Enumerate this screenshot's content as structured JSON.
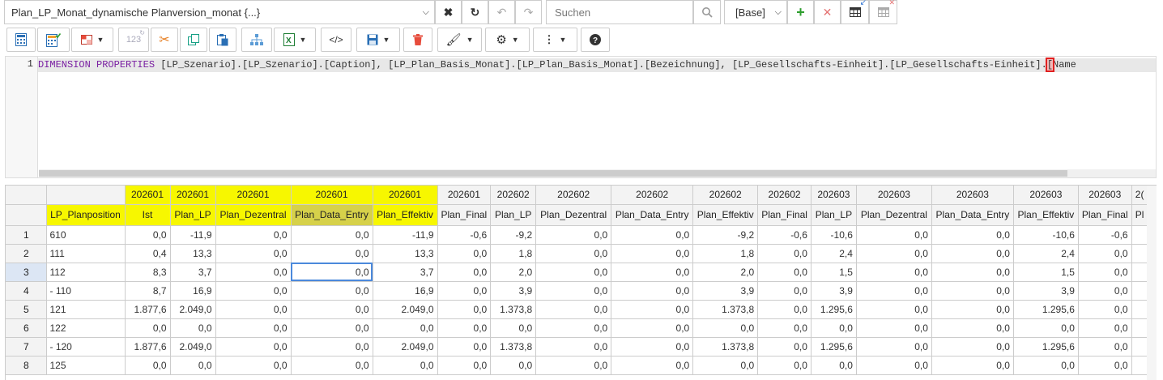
{
  "topbar": {
    "query_select": "Plan_LP_Monat_dynamische Planversion_monat {...}",
    "search_placeholder": "Suchen",
    "database_select": "[Base]"
  },
  "toolbar": {
    "paging_label": "123"
  },
  "editor": {
    "line_number": "1",
    "code_kw1": "DIMENSION PROPERTIES",
    "code_text": " [LP_Szenario].[LP_Szenario].[Caption], [LP_Plan_Basis_Monat].[LP_Plan_Basis_Monat].[Bezeichnung], [LP_Gesellschafts-Einheit].[LP_Gesellschafts-Einheit].",
    "code_bracket": "[",
    "code_tail": "Name"
  },
  "grid": {
    "header_periods": [
      "202601",
      "202601",
      "202601",
      "202601",
      "202601",
      "202601",
      "202602",
      "202602",
      "202602",
      "202602",
      "202602",
      "202603",
      "202603",
      "202603",
      "202603",
      "202603",
      "2("
    ],
    "row_header_title": "LP_Planposition",
    "header_measures": [
      "Ist",
      "Plan_LP",
      "Plan_Dezentral",
      "Plan_Data_Entry",
      "Plan_Effektiv",
      "Plan_Final",
      "Plan_LP",
      "Plan_Dezentral",
      "Plan_Data_Entry",
      "Plan_Effektiv",
      "Plan_Final",
      "Plan_LP",
      "Plan_Dezentral",
      "Plan_Data_Entry",
      "Plan_Effektiv",
      "Plan_Final",
      "Pl"
    ],
    "rows": [
      {
        "num": "1",
        "label": "610",
        "values": [
          "0,0",
          "-11,9",
          "0,0",
          "0,0",
          "-11,9",
          "-0,6",
          "-9,2",
          "0,0",
          "0,0",
          "-9,2",
          "-0,6",
          "-10,6",
          "0,0",
          "0,0",
          "-10,6",
          "-0,6"
        ]
      },
      {
        "num": "2",
        "label": "111",
        "values": [
          "0,4",
          "13,3",
          "0,0",
          "0,0",
          "13,3",
          "0,0",
          "1,8",
          "0,0",
          "0,0",
          "1,8",
          "0,0",
          "2,4",
          "0,0",
          "0,0",
          "2,4",
          "0,0"
        ]
      },
      {
        "num": "3",
        "label": "112",
        "values": [
          "8,3",
          "3,7",
          "0,0",
          "0,0",
          "3,7",
          "0,0",
          "2,0",
          "0,0",
          "0,0",
          "2,0",
          "0,0",
          "1,5",
          "0,0",
          "0,0",
          "1,5",
          "0,0"
        ]
      },
      {
        "num": "4",
        "label": "- 110",
        "values": [
          "8,7",
          "16,9",
          "0,0",
          "0,0",
          "16,9",
          "0,0",
          "3,9",
          "0,0",
          "0,0",
          "3,9",
          "0,0",
          "3,9",
          "0,0",
          "0,0",
          "3,9",
          "0,0"
        ]
      },
      {
        "num": "5",
        "label": "121",
        "values": [
          "1.877,6",
          "2.049,0",
          "0,0",
          "0,0",
          "2.049,0",
          "0,0",
          "1.373,8",
          "0,0",
          "0,0",
          "1.373,8",
          "0,0",
          "1.295,6",
          "0,0",
          "0,0",
          "1.295,6",
          "0,0"
        ]
      },
      {
        "num": "6",
        "label": "122",
        "values": [
          "0,0",
          "0,0",
          "0,0",
          "0,0",
          "0,0",
          "0,0",
          "0,0",
          "0,0",
          "0,0",
          "0,0",
          "0,0",
          "0,0",
          "0,0",
          "0,0",
          "0,0",
          "0,0"
        ]
      },
      {
        "num": "7",
        "label": "- 120",
        "values": [
          "1.877,6",
          "2.049,0",
          "0,0",
          "0,0",
          "2.049,0",
          "0,0",
          "1.373,8",
          "0,0",
          "0,0",
          "1.373,8",
          "0,0",
          "1.295,6",
          "0,0",
          "0,0",
          "1.295,6",
          "0,0"
        ]
      },
      {
        "num": "8",
        "label": "125",
        "values": [
          "0,0",
          "0,0",
          "0,0",
          "0,0",
          "0,0",
          "0,0",
          "0,0",
          "0,0",
          "0,0",
          "0,0",
          "0,0",
          "0,0",
          "0,0",
          "0,0",
          "0,0",
          "0,0"
        ]
      }
    ]
  },
  "colors": {
    "highlight": "#f7f700",
    "selection": "#4b89dc",
    "keyword": "#7a1fa2"
  }
}
